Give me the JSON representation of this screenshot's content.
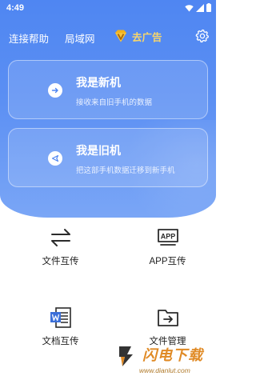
{
  "status_bar": {
    "time": "4:49"
  },
  "top_nav": {
    "help_link": "连接帮助",
    "lan_link": "局域网",
    "ad_button": "去广告",
    "colors": {
      "ad_text": "#f8d66b",
      "vip_badge": "#f2b21c"
    }
  },
  "cards": [
    {
      "title": "我是新机",
      "description": "接收来自旧手机的数据",
      "icon": "arrow-right-icon"
    },
    {
      "title": "我是旧机",
      "description": "把这部手机数据迁移到新手机",
      "icon": "send-icon"
    }
  ],
  "features": [
    {
      "label": "文件互传",
      "icon": "swap-arrows-icon"
    },
    {
      "label": "APP互传",
      "icon": "app-box-icon",
      "icon_text": "APP"
    },
    {
      "label": "文档互传",
      "icon": "word-document-icon"
    },
    {
      "label": "文件管理",
      "icon": "folder-arrow-icon"
    }
  ],
  "watermark": {
    "title": "闪电下载",
    "url": "www.dianlut.com"
  },
  "colors": {
    "primary": "#4f86f2",
    "text": "#222222"
  }
}
